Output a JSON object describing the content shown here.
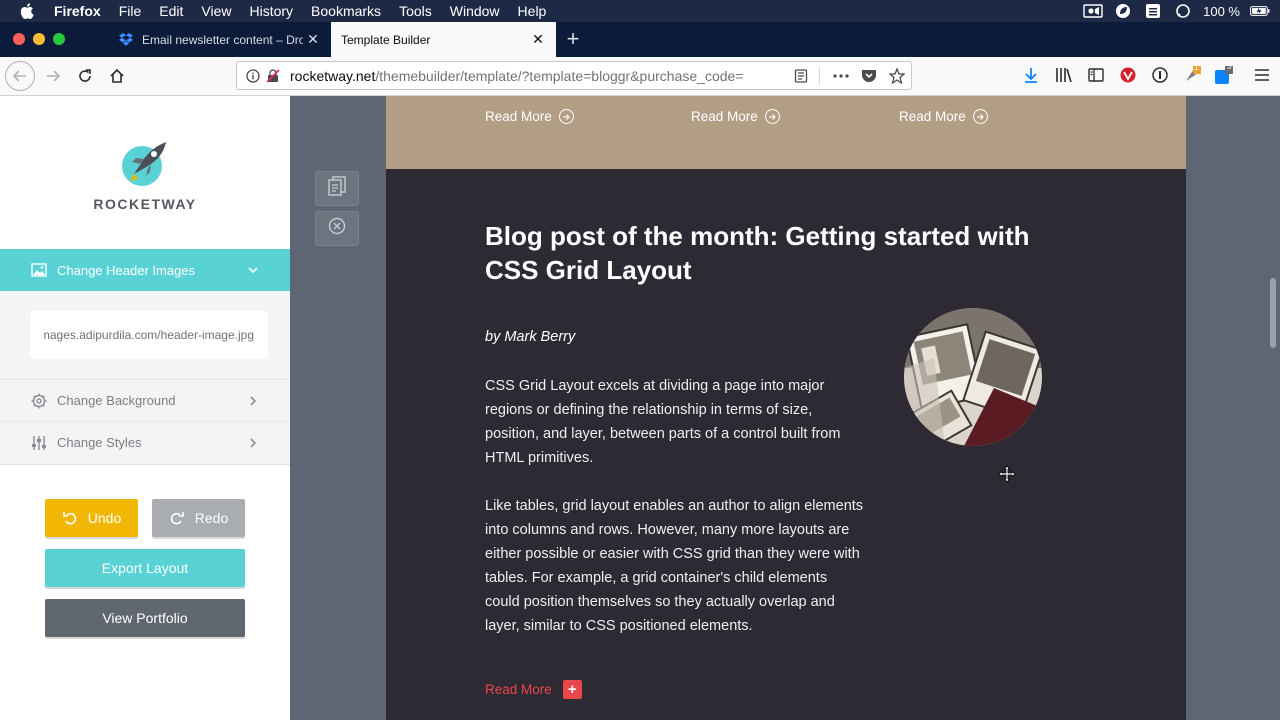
{
  "menubar": {
    "app_name": "Firefox",
    "items": [
      "File",
      "Edit",
      "View",
      "History",
      "Bookmarks",
      "Tools",
      "Window",
      "Help"
    ],
    "battery": "100 %"
  },
  "tabs": [
    {
      "title": "Email newsletter content – Drop",
      "icon": "dropbox-icon",
      "active": false
    },
    {
      "title": "Template Builder",
      "icon": "",
      "active": true
    }
  ],
  "urlbar": {
    "domain": "rocketway.net",
    "path": "/themebuilder/template/?template=bloggr&purchase_code="
  },
  "toolbar": {
    "download_badge": "",
    "ext_badge_1": "1",
    "ext_badge_2": "3"
  },
  "sidebar": {
    "brand": "ROCKETWAY",
    "sections": {
      "header_images": "Change Header Images",
      "header_image_url": "https://images.adipurdila.com/header-image.jpg",
      "background": "Change Background",
      "styles": "Change Styles"
    },
    "buttons": {
      "undo": "Undo",
      "redo": "Redo",
      "export": "Export Layout",
      "portfolio": "View Portfolio"
    }
  },
  "email": {
    "read_more_top": [
      "Read More",
      "Read More",
      "Read More"
    ],
    "post_title": "Blog post of the month: Getting started with CSS Grid Layout",
    "author": "by Mark Berry",
    "paragraph_1": "CSS Grid Layout excels at dividing a page into major regions or defining the relationship in terms of size, position, and layer, between parts of a control built from HTML primitives.",
    "paragraph_2": "Like tables, grid layout enables an author to align elements into columns and rows. However, many more layouts are either possible or easier with CSS grid than they were with tables. For example, a grid container's child elements could position themselves so they actually overlap and layer, similar to CSS positioned elements.",
    "read_more_bottom": "Read More"
  },
  "colors": {
    "accent": "#59d2d5",
    "undo": "#f2b705",
    "redo": "#a9adb2",
    "portfolio": "#606770",
    "email_top_band": "#b29e85",
    "email_body": "#2e2a33",
    "read_more_red": "#e8474b"
  }
}
